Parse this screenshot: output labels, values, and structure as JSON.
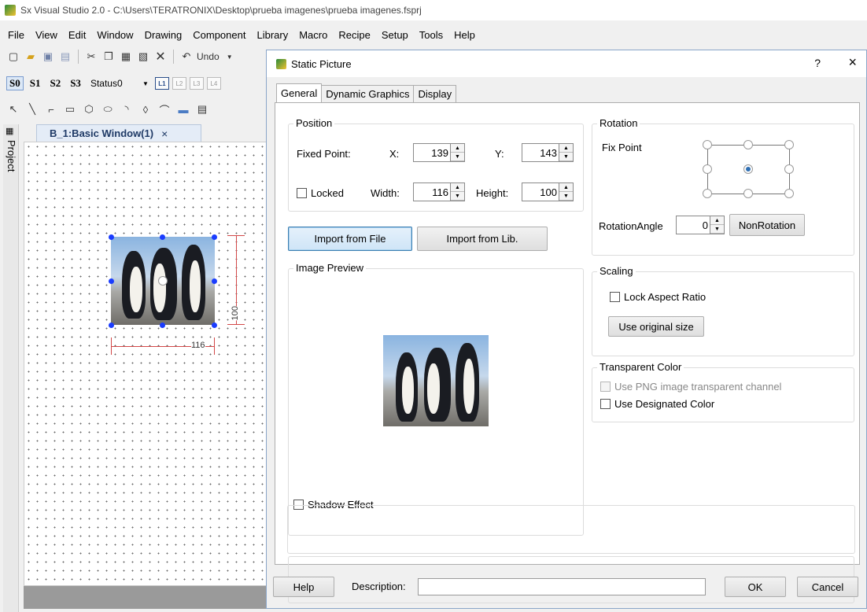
{
  "app": {
    "title": "Sx Visual Studio 2.0 - C:\\Users\\TERATRONIX\\Desktop\\prueba imagenes\\prueba imagenes.fsprj"
  },
  "menu": [
    "File",
    "View",
    "Edit",
    "Window",
    "Drawing",
    "Component",
    "Library",
    "Macro",
    "Recipe",
    "Setup",
    "Tools",
    "Help"
  ],
  "toolbar": {
    "undo_label": "Undo",
    "status_select": "Status0",
    "s_buttons": [
      "S0",
      "S1",
      "S2",
      "S3"
    ],
    "l_buttons": [
      "L1",
      "L2",
      "L3",
      "L4"
    ]
  },
  "side": {
    "project_label": "Project"
  },
  "editor": {
    "tab_label": "B_1:Basic Window(1)",
    "tab_close": "×",
    "dim_width": "116",
    "dim_height": "100"
  },
  "dialog": {
    "title": "Static Picture",
    "help_glyph": "?",
    "close_glyph": "×",
    "tabs": [
      "General",
      "Dynamic Graphics",
      "Display"
    ],
    "position": {
      "label": "Position",
      "fixed_point_label": "Fixed Point:",
      "x_label": "X:",
      "x_value": "139",
      "y_label": "Y:",
      "y_value": "143",
      "locked_label": "Locked",
      "width_label": "Width:",
      "width_value": "116",
      "height_label": "Height:",
      "height_value": "100"
    },
    "rotation": {
      "label": "Rotation",
      "fix_point_label": "Fix Point",
      "angle_label": "RotationAngle",
      "angle_value": "0",
      "nonrotation_label": "NonRotation"
    },
    "import_file_label": "Import from File",
    "import_lib_label": "Import from Lib.",
    "preview_label": "Image Preview",
    "scaling": {
      "label": "Scaling",
      "lock_aspect_label": "Lock Aspect Ratio",
      "original_size_label": "Use original size"
    },
    "transparent": {
      "label": "Transparent Color",
      "png_channel_label": "Use PNG image transparent channel",
      "designated_label": "Use Designated Color"
    },
    "shadow_label": "Shadow Effect",
    "help_button": "Help",
    "description_label": "Description:",
    "description_value": "",
    "ok_button": "OK",
    "cancel_button": "Cancel"
  }
}
